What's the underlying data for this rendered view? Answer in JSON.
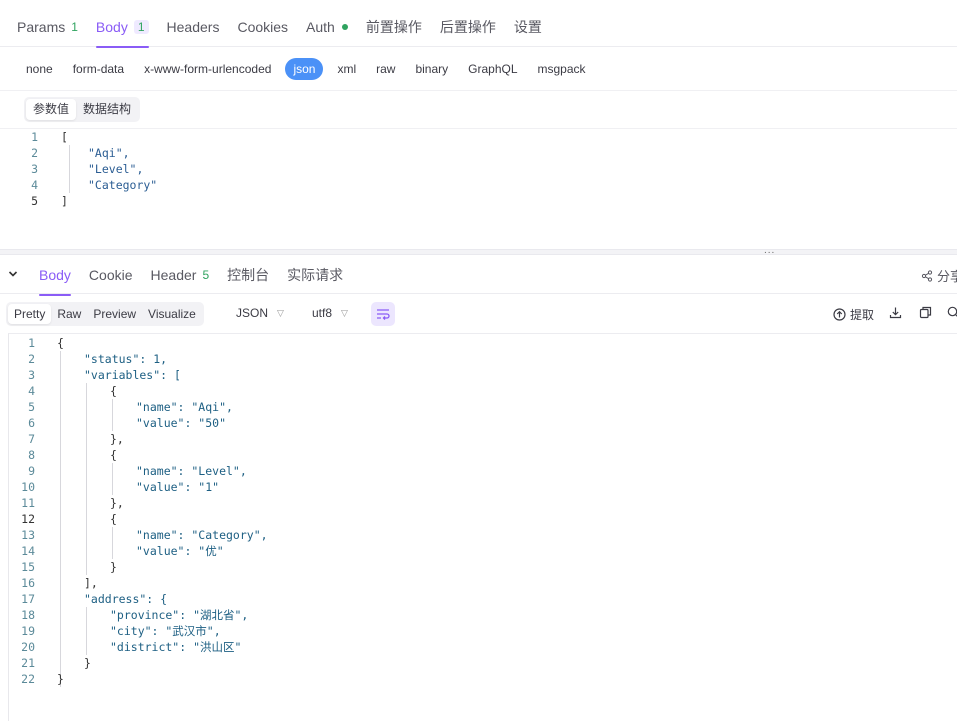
{
  "request_tabs": [
    {
      "label": "Params",
      "count": "1"
    },
    {
      "label": "Body",
      "count": "1"
    },
    {
      "label": "Headers"
    },
    {
      "label": "Cookies"
    },
    {
      "label": "Auth"
    },
    {
      "label": "前置操作"
    },
    {
      "label": "后置操作"
    },
    {
      "label": "设置"
    }
  ],
  "body_types": [
    "none",
    "form-data",
    "x-www-form-urlencoded",
    "json",
    "xml",
    "raw",
    "binary",
    "GraphQL",
    "msgpack"
  ],
  "active_body_type": "json",
  "body_subtabs": [
    "参数值",
    "数据结构"
  ],
  "request_body_lines": [
    {
      "n": "1",
      "text": "["
    },
    {
      "n": "2",
      "text": "\"Aqi\","
    },
    {
      "n": "3",
      "text": "\"Level\","
    },
    {
      "n": "4",
      "text": "\"Category\""
    },
    {
      "n": "5",
      "text": "]"
    }
  ],
  "splitter_handle": "...",
  "response_tabs": [
    {
      "label": "Body"
    },
    {
      "label": "Cookie"
    },
    {
      "label": "Header",
      "count": "5"
    },
    {
      "label": "控制台"
    },
    {
      "label": "实际请求"
    }
  ],
  "share_label": "分享",
  "view_modes": [
    "Pretty",
    "Raw",
    "Preview",
    "Visualize"
  ],
  "format_select": "JSON",
  "encoding_select": "utf8",
  "extract_label": "提取",
  "response_lines": [
    {
      "n": "1",
      "text": "{"
    },
    {
      "n": "2",
      "text": "\"status\": 1,"
    },
    {
      "n": "3",
      "text": "\"variables\": ["
    },
    {
      "n": "4",
      "text": "{"
    },
    {
      "n": "5",
      "text": "\"name\": \"Aqi\","
    },
    {
      "n": "6",
      "text": "\"value\": \"50\""
    },
    {
      "n": "7",
      "text": "},"
    },
    {
      "n": "8",
      "text": "{"
    },
    {
      "n": "9",
      "text": "\"name\": \"Level\","
    },
    {
      "n": "10",
      "text": "\"value\": \"1\""
    },
    {
      "n": "11",
      "text": "},"
    },
    {
      "n": "12",
      "text": "{"
    },
    {
      "n": "13",
      "text": "\"name\": \"Category\","
    },
    {
      "n": "14",
      "text": "\"value\": \"优\""
    },
    {
      "n": "15",
      "text": "}"
    },
    {
      "n": "16",
      "text": "],"
    },
    {
      "n": "17",
      "text": "\"address\": {"
    },
    {
      "n": "18",
      "text": "\"province\": \"湖北省\","
    },
    {
      "n": "19",
      "text": "\"city\": \"武汉市\","
    },
    {
      "n": "20",
      "text": "\"district\": \"洪山区\""
    },
    {
      "n": "21",
      "text": "}"
    },
    {
      "n": "22",
      "text": "}"
    }
  ],
  "colors": {
    "accent": "#8a5cf6",
    "json_pill": "#4b91f7",
    "status_green": "#2fa35f"
  }
}
